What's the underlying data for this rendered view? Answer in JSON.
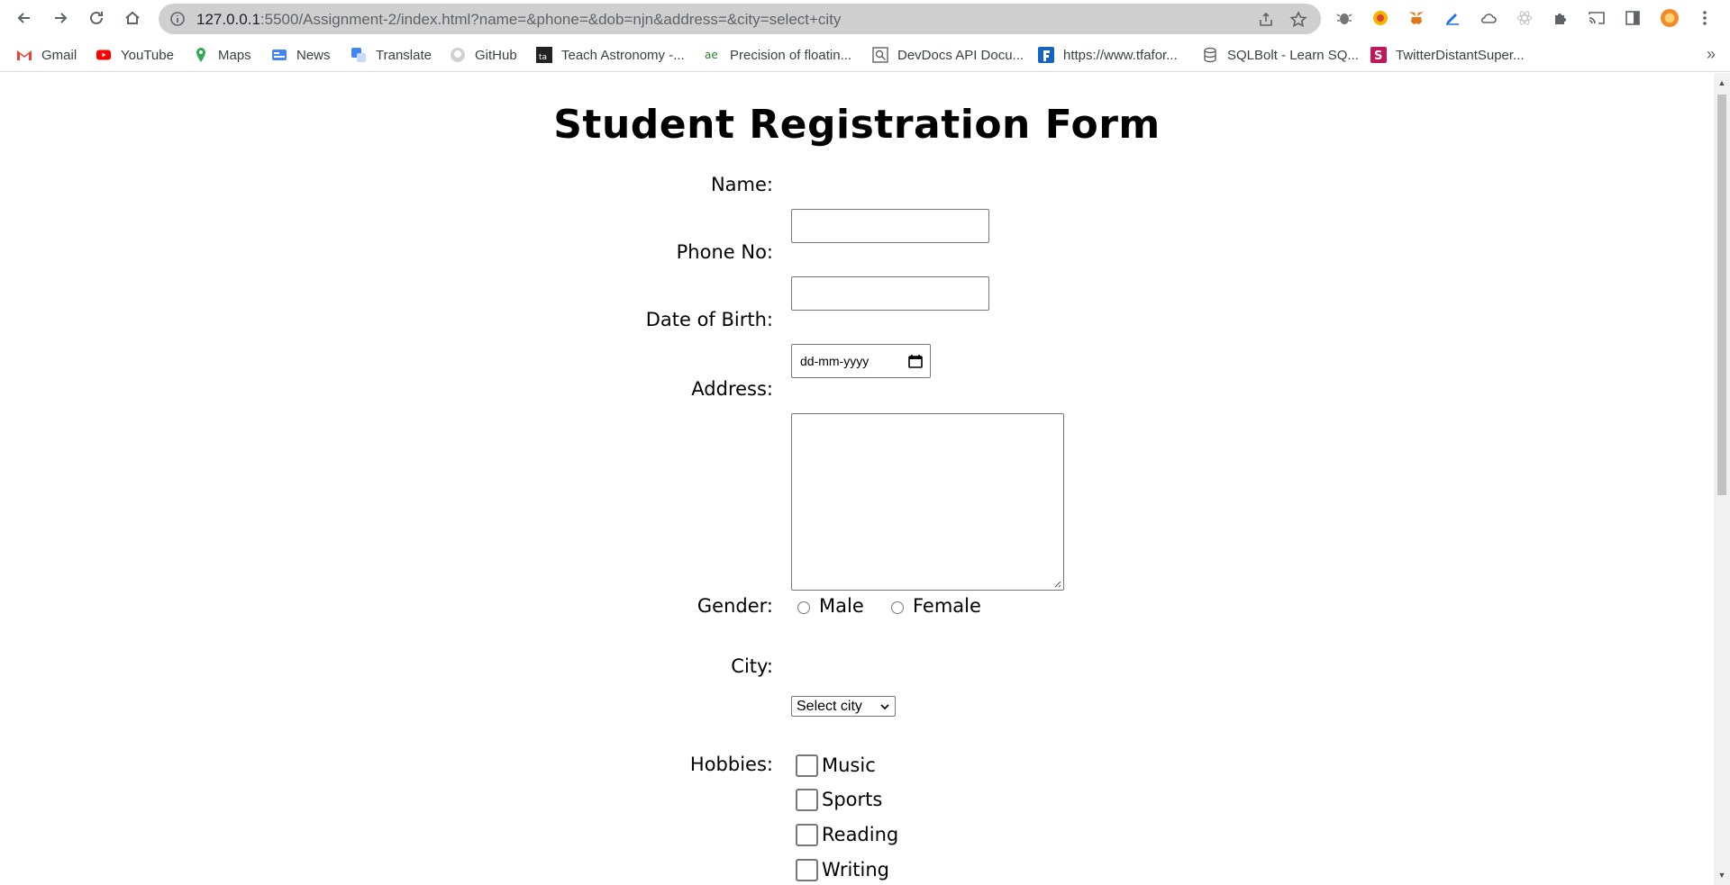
{
  "browser": {
    "url_host": "127.0.0.1",
    "url_rest": ":5500/Assignment-2/index.html?name=&phone=&dob=njn&address=&city=select+city",
    "bookmarks": [
      {
        "label": "Gmail",
        "icon": "gmail-icon"
      },
      {
        "label": "YouTube",
        "icon": "youtube-icon"
      },
      {
        "label": "Maps",
        "icon": "maps-icon"
      },
      {
        "label": "News",
        "icon": "news-icon"
      },
      {
        "label": "Translate",
        "icon": "translate-icon"
      },
      {
        "label": "GitHub",
        "icon": "github-icon"
      },
      {
        "label": "Teach Astronomy -...",
        "icon": "teach-astronomy-icon"
      },
      {
        "label": "Precision of floatin...",
        "icon": "precision-icon"
      },
      {
        "label": "DevDocs API Docu...",
        "icon": "devdocs-icon"
      },
      {
        "label": "https://www.tfafor...",
        "icon": "tfa-icon"
      },
      {
        "label": "SQLBolt - Learn SQ...",
        "icon": "sqlbolt-icon"
      },
      {
        "label": "TwitterDistantSuper...",
        "icon": "twitter-super-icon"
      }
    ],
    "overflow": "»"
  },
  "form": {
    "title": "Student Registration Form",
    "name_label": "Name:",
    "name_value": "",
    "phone_label": "Phone No:",
    "phone_value": "",
    "dob_label": "Date of Birth:",
    "dob_placeholder": "dd-mm-yyyy",
    "address_label": "Address:",
    "address_value": "",
    "gender_label": "Gender:",
    "gender_options": [
      "Male",
      "Female"
    ],
    "city_label": "City:",
    "city_selected": "Select city",
    "hobbies_label": "Hobbies:",
    "hobbies": [
      "Music",
      "Sports",
      "Reading",
      "Writing"
    ]
  },
  "colors": {
    "omnibox_bg": "#cfcfd0",
    "youtube_red": "#ff0000",
    "profile_orange": "#f28b26"
  }
}
